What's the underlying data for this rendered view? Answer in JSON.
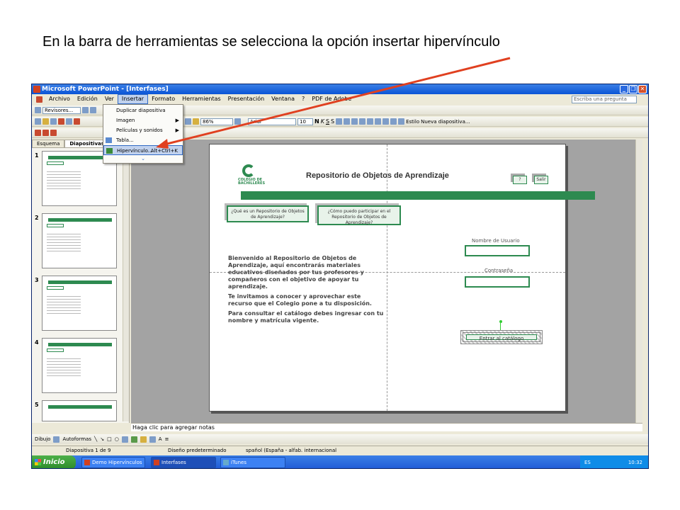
{
  "caption": "En la barra de herramientas se selecciona la opción insertar hipervínculo",
  "window": {
    "title": "Microsoft PowerPoint - [Interfases]",
    "help_placeholder": "Escriba una pregunta"
  },
  "menubar": [
    {
      "label": "Archivo"
    },
    {
      "label": "Edición"
    },
    {
      "label": "Ver"
    },
    {
      "label": "Insertar"
    },
    {
      "label": "Formato"
    },
    {
      "label": "Herramientas"
    },
    {
      "label": "Presentación"
    },
    {
      "label": "Ventana"
    },
    {
      "label": "?"
    },
    {
      "label": "PDF de Adobe"
    }
  ],
  "toolbar": {
    "revisores": "Revisores...",
    "zoom": "86%",
    "font": "Arial",
    "size": "10",
    "design": "Estilo",
    "new_slide": "Nueva diapositiva..."
  },
  "insert_menu": {
    "items": [
      {
        "label": "Duplicar diapositiva",
        "shortcut": "",
        "arrow": ""
      },
      {
        "label": "Imagen",
        "shortcut": "",
        "arrow": "▶"
      },
      {
        "label": "Películas y sonidos",
        "shortcut": "",
        "arrow": "▶"
      },
      {
        "label": "Tabla...",
        "shortcut": "",
        "arrow": ""
      },
      {
        "label": "Hipervínculo...",
        "shortcut": "Alt+Ctrl+K",
        "arrow": ""
      }
    ],
    "more": "⌄"
  },
  "side_panel": {
    "tab1": "Esquema",
    "tab2": "Diapositivas",
    "slides": [
      "1",
      "2",
      "3",
      "4",
      "5"
    ]
  },
  "slide": {
    "title": "Repositorio de Objetos de Aprendizaje",
    "logo_text": "COLEGIO DE BACHILLERES",
    "btn_help": "?",
    "btn_exit": "Salir",
    "btn_que": "¿Qué es un Repositorio de Objetos de Aprendizaje?",
    "btn_como": "¿Cómo puedo participar en el Repositorio de Objetos de Aprendizaje?",
    "paragraph1": "Bienvenido al Repositorio de Objetos de Aprendizaje, aquí encontrarás materiales educativos diseñados por tus profesores y compañeros con el objetivo de apoyar tu aprendizaje.",
    "paragraph2": "Te invitamos a conocer y aprovechar este recurso que el Colegio pone a tu disposición.",
    "paragraph3": "Para consultar el catálogo debes ingresar con tu nombre y matrícula vigente.",
    "user_label": "Nombre de Usuario",
    "pass_label": "Contraseña",
    "enter_btn": "Entrar al catálogo"
  },
  "notes": "Haga clic para agregar notas",
  "drawbar": {
    "dibujo": "Dibujo",
    "autoformas": "Autoformas"
  },
  "status": {
    "slide": "Diapositiva 1 de 9",
    "design": "Diseño predeterminado",
    "lang": "spañol (España - alfab. internacional"
  },
  "taskbar": {
    "start": "Inicio",
    "tasks": [
      "Demo Hipervínculos",
      "Interfases",
      "iTunes"
    ],
    "lang": "ES",
    "time": "10:32"
  },
  "colors": {
    "accent_green": "#2d8a50",
    "arrow_red": "#e04020"
  }
}
